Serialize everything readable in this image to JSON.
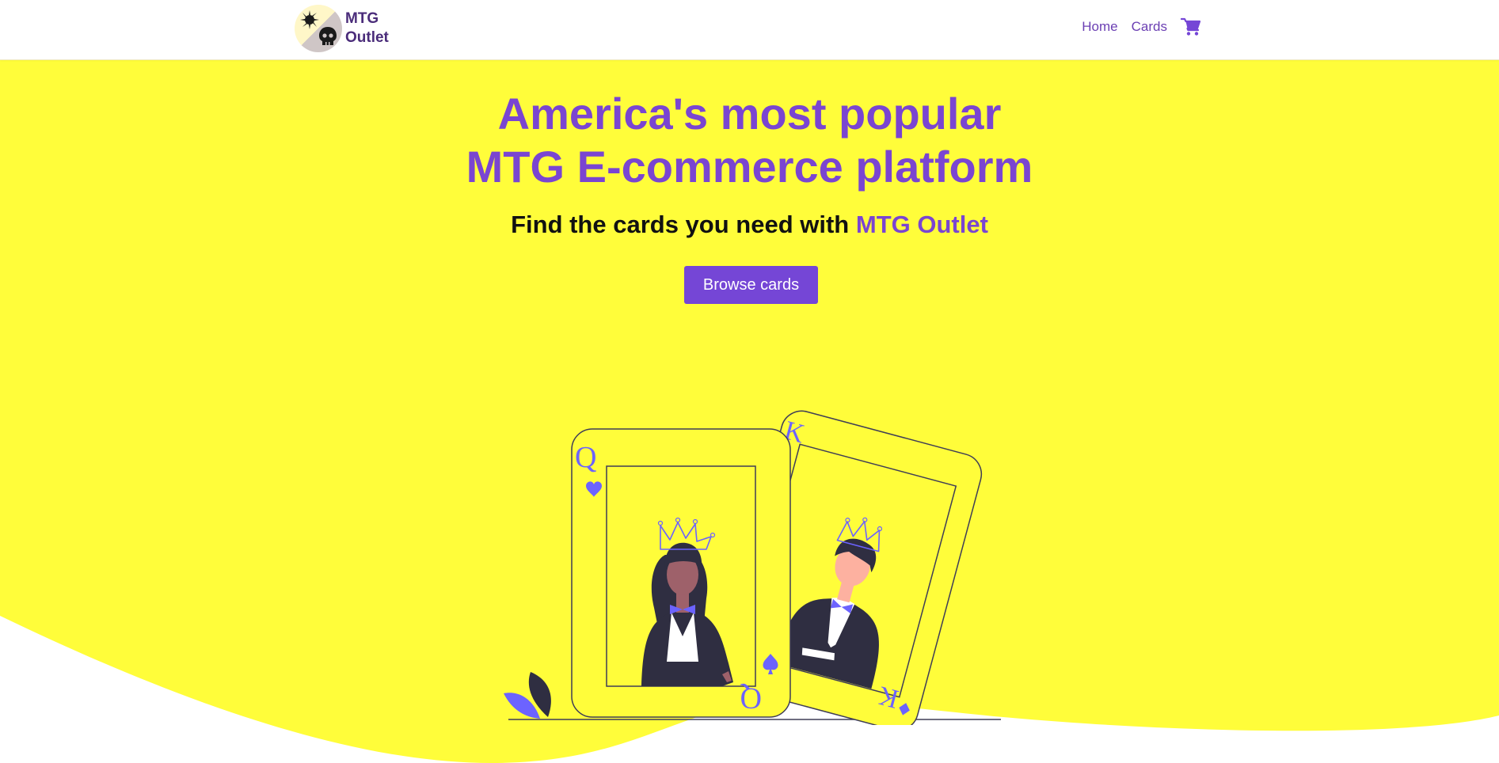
{
  "nav": {
    "brand_line1": "MTG",
    "brand_line2": "Outlet",
    "links": [
      {
        "label": "Home"
      },
      {
        "label": "Cards"
      }
    ],
    "cart_icon": "shopping-cart-icon"
  },
  "hero": {
    "title_line1": "America's most popular",
    "title_line2": "MTG E-commerce platform",
    "subtitle_prefix": "Find the cards you need with",
    "subtitle_accent": "MTG Outlet",
    "cta_label": "Browse cards"
  },
  "illustration": {
    "queen_rank": "Q",
    "king_rank": "K"
  },
  "colors": {
    "accent": "#7a45d1",
    "button": "#7546d6",
    "hero_background": "#fffd3a",
    "figure_accent": "#6c63ff"
  }
}
